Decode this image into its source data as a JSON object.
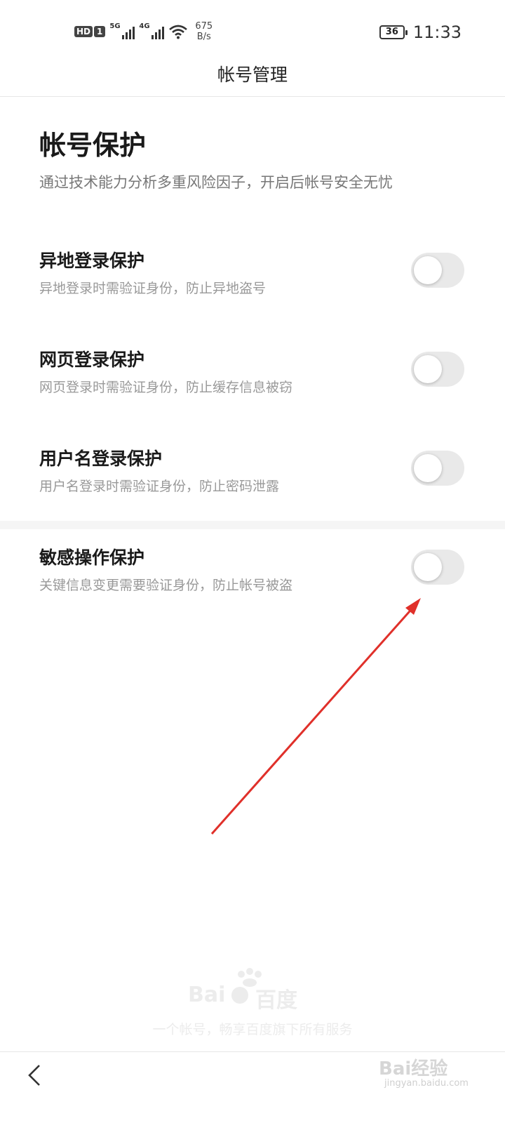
{
  "status_bar": {
    "hd": "HD",
    "sim": "1",
    "signal1_gen": "5G",
    "signal2_gen": "4G",
    "speed_value": "675",
    "speed_unit": "B/s",
    "battery": "36",
    "time": "11:33"
  },
  "header": {
    "title": "帐号管理"
  },
  "section": {
    "title": "帐号保护",
    "desc": "通过技术能力分析多重风险因子，开启后帐号安全无忧"
  },
  "settings": [
    {
      "title": "异地登录保护",
      "desc": "异地登录时需验证身份，防止异地盗号",
      "enabled": false
    },
    {
      "title": "网页登录保护",
      "desc": "网页登录时需验证身份，防止缓存信息被窃",
      "enabled": false
    },
    {
      "title": "用户名登录保护",
      "desc": "用户名登录时需验证身份，防止密码泄露",
      "enabled": false
    },
    {
      "title": "敏感操作保护",
      "desc": "关键信息变更需要验证身份，防止帐号被盗",
      "enabled": false
    }
  ],
  "footer": {
    "logo_text_1": "Bai",
    "logo_text_2": "百度",
    "slogan": "一个帐号，畅享百度旗下所有服务"
  },
  "watermark": {
    "text": "Bai经验",
    "url": "jingyan.baidu.com"
  },
  "colors": {
    "toggle_off": "#e9e9e9",
    "annotation_arrow": "#e0302a"
  }
}
